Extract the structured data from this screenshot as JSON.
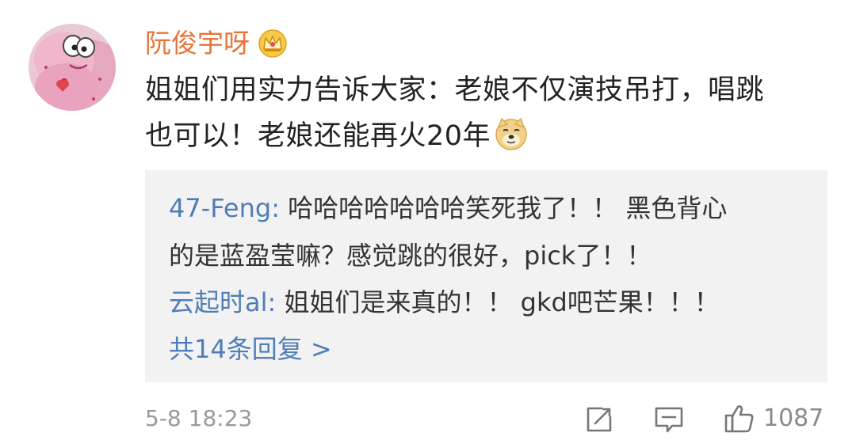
{
  "comment": {
    "username": "阮俊宇呀",
    "badge_icon": "crown-badge-icon",
    "text_line1": "姐姐们用实力告诉大家：老娘不仅演技吊打，唱跳",
    "text_line2": "也可以！老娘还能再火20年",
    "emoji_icon": "doge-emoji-icon",
    "colors": {
      "username": "#e8743a",
      "text": "#222222",
      "link": "#4f7db7",
      "meta": "#999999",
      "reply_bg": "#f2f2f2"
    }
  },
  "replies": [
    {
      "author": "47-Feng:",
      "text_line1": " 哈哈哈哈哈哈哈笑死我了！！ 黑色背心",
      "text_line2": "的是蓝盈莹嘛？感觉跳的很好，pick了！！"
    },
    {
      "author": "云起时al:",
      "text_line1": " 姐姐们是来真的！！ gkd吧芒果！！！"
    }
  ],
  "more_replies": "共14条回复 >",
  "footer": {
    "timestamp": "5-8 18:23",
    "share_icon": "share-icon",
    "comment_icon": "comment-icon",
    "like_icon": "thumbs-up-icon",
    "like_count": "1087"
  }
}
